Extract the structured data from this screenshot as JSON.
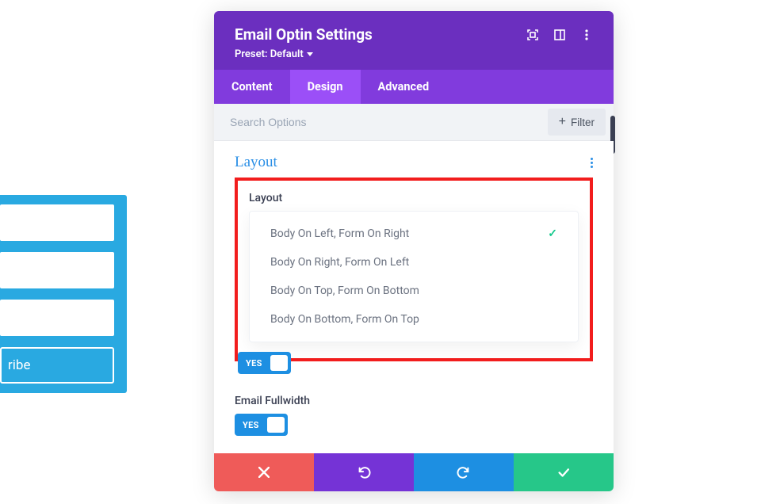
{
  "preview": {
    "subscribe_fragment": "ribe"
  },
  "panel": {
    "title": "Email Optin Settings",
    "preset_label": "Preset: Default",
    "tabs": {
      "content": "Content",
      "design": "Design",
      "advanced": "Advanced",
      "active": "design"
    },
    "search_placeholder": "Search Options",
    "filter_label": "Filter",
    "section_title": "Layout",
    "layout_field_label": "Layout",
    "layout_options": [
      {
        "label": "Body On Left, Form On Right",
        "selected": true
      },
      {
        "label": "Body On Right, Form On Left",
        "selected": false
      },
      {
        "label": "Body On Top, Form On Bottom",
        "selected": false
      },
      {
        "label": "Body On Bottom, Form On Top",
        "selected": false
      }
    ],
    "toggle_peek_label": "YES",
    "email_fullwidth_label": "Email Fullwidth",
    "email_fullwidth_toggle": "YES"
  }
}
